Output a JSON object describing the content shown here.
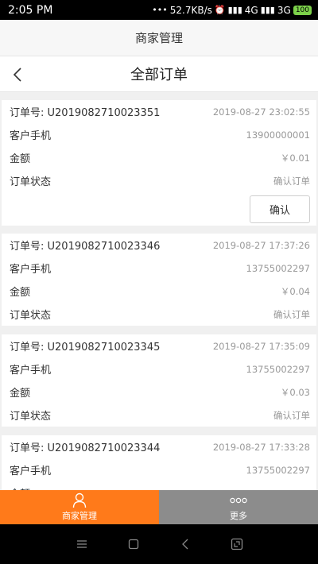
{
  "status_bar": {
    "time": "2:05 PM",
    "speed": "52.7KB/s",
    "network_a": "4G",
    "network_b": "3G",
    "battery": "100"
  },
  "app_header": {
    "title": "商家管理"
  },
  "page_header": {
    "title": "全部订单"
  },
  "labels": {
    "order_no": "订单号: ",
    "customer_phone": "客户手机",
    "amount": "金额",
    "status": "订单状态"
  },
  "orders": [
    {
      "order_no": "U2019082710023351",
      "datetime": "2019-08-27 23:02:55",
      "phone": "13900000001",
      "amount": "￥0.01",
      "status": "确认订单",
      "confirm_label": "确认"
    },
    {
      "order_no": "U2019082710023346",
      "datetime": "2019-08-27 17:37:26",
      "phone": "13755002297",
      "amount": "￥0.04",
      "status": "确认订单"
    },
    {
      "order_no": "U2019082710023345",
      "datetime": "2019-08-27 17:35:09",
      "phone": "13755002297",
      "amount": "￥0.03",
      "status": "确认订单"
    },
    {
      "order_no": "U2019082710023344",
      "datetime": "2019-08-27 17:33:28",
      "phone": "13755002297",
      "amount": "",
      "status": ""
    }
  ],
  "tabs": [
    {
      "label": "商家管理",
      "icon": "person-icon",
      "active": true
    },
    {
      "label": "更多",
      "icon": "more-dots-icon",
      "active": false
    }
  ],
  "colors": {
    "accent": "#ff7a1a",
    "inactive_tab": "#8c8c8c",
    "muted_text": "#999999"
  }
}
